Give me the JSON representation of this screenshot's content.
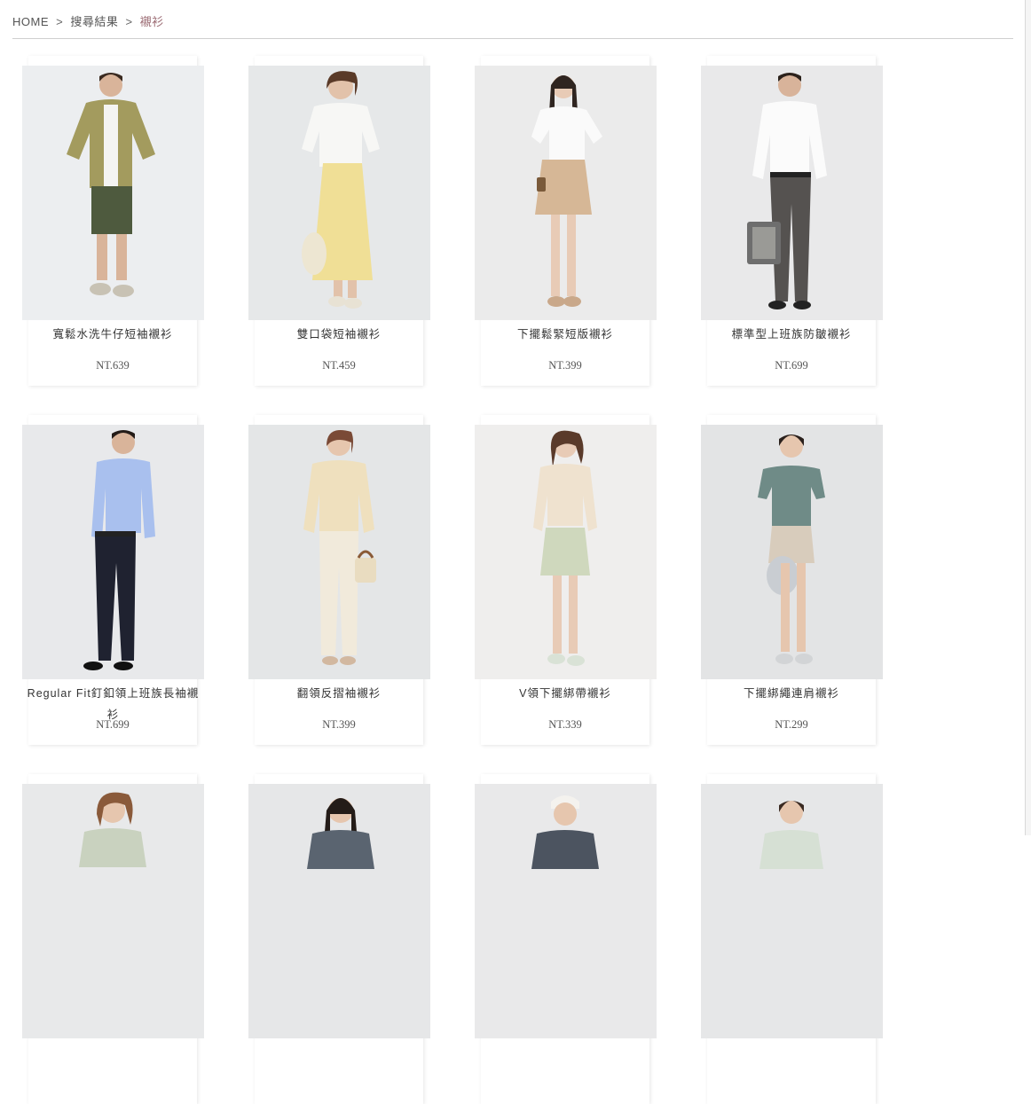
{
  "breadcrumb": {
    "home": "HOME",
    "separator": ">",
    "search": "搜尋結果",
    "current": "襯衫"
  },
  "products": [
    {
      "name": "寬鬆水洗牛仔短袖襯衫",
      "price": "NT.639"
    },
    {
      "name": "雙口袋短袖襯衫",
      "price": "NT.459"
    },
    {
      "name": "下擺鬆緊短版襯衫",
      "price": "NT.399"
    },
    {
      "name": "標準型上班族防皺襯衫",
      "price": "NT.699"
    },
    {
      "name": "Regular Fit釘釦領上班族長袖襯衫",
      "price": "NT.699"
    },
    {
      "name": "翻領反摺袖襯衫",
      "price": "NT.399"
    },
    {
      "name": "V領下擺綁帶襯衫",
      "price": "NT.339"
    },
    {
      "name": "下擺綁繩連肩襯衫",
      "price": "NT.299"
    },
    {
      "name": "",
      "price": ""
    },
    {
      "name": "",
      "price": ""
    },
    {
      "name": "",
      "price": ""
    },
    {
      "name": "",
      "price": ""
    }
  ],
  "colors": {
    "accent": "#9b6b73",
    "divider": "#cfcfcf"
  }
}
